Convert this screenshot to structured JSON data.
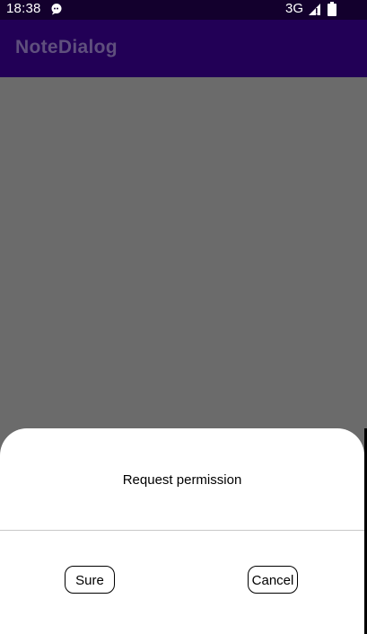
{
  "status_bar": {
    "time": "18:38",
    "network": "3G",
    "icons": [
      "notification-icon",
      "signal-icon",
      "battery-icon"
    ]
  },
  "app_bar": {
    "title": "NoteDialog"
  },
  "dialog": {
    "message": "Request permission",
    "sure_label": "Sure",
    "cancel_label": "Cancel"
  },
  "colors": {
    "status_bar_bg": "#13002d",
    "app_bar_bg": "#220056",
    "app_title": "#5f4f7d",
    "scrim": "#6b6b6b",
    "dialog_bg": "#ffffff"
  }
}
